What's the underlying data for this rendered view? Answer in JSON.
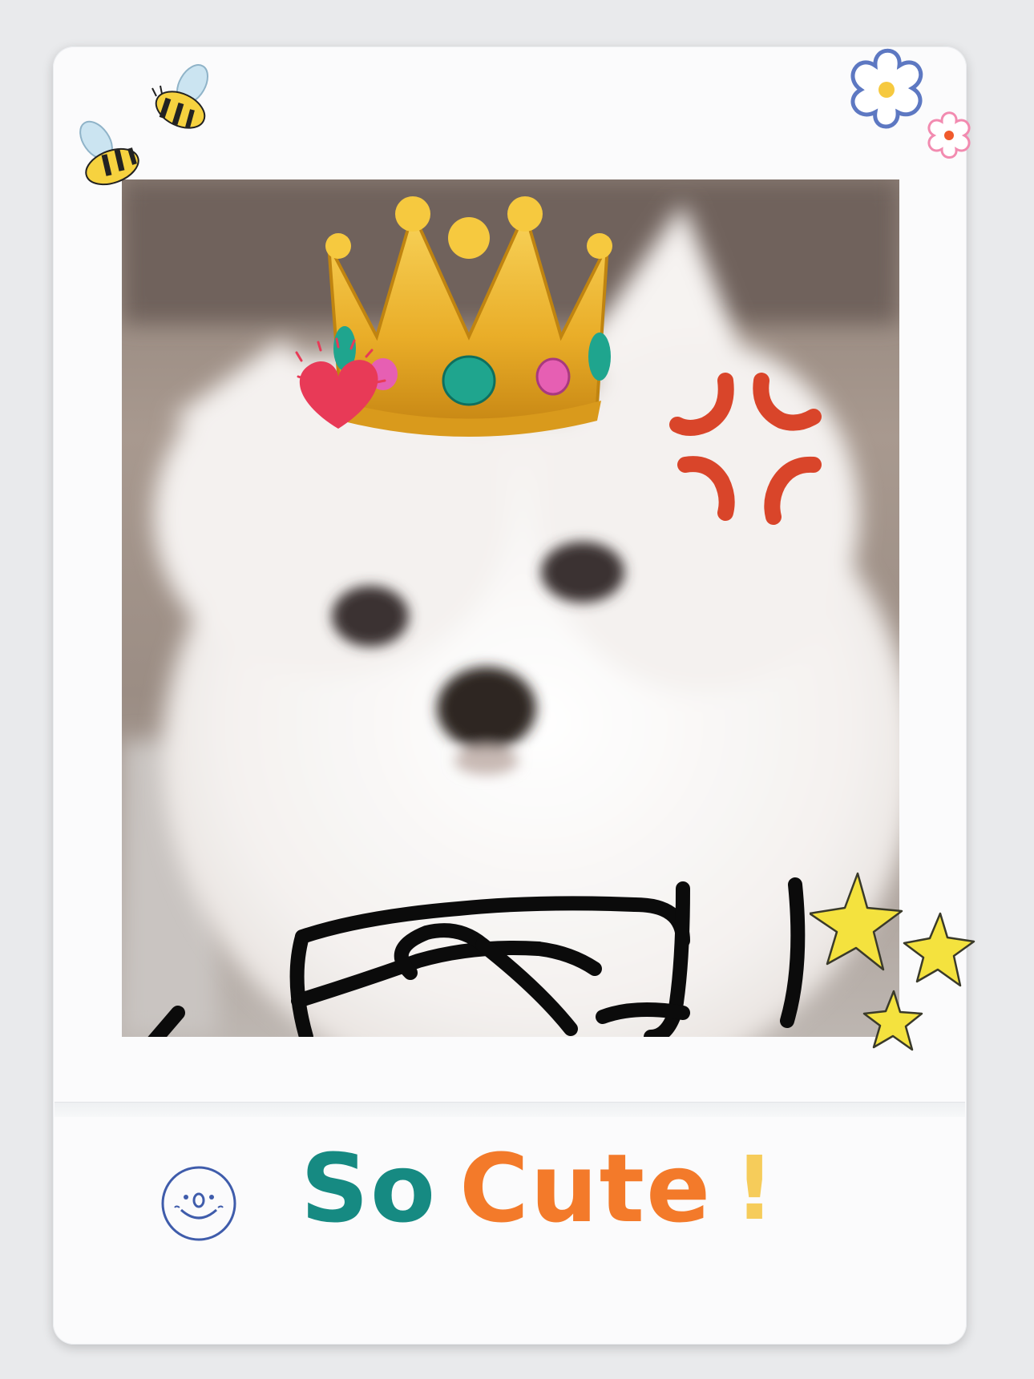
{
  "caption": {
    "word1": "So",
    "word2": "Cute",
    "punct": "!"
  },
  "colors": {
    "frame": "#fbfbfc",
    "background": "#e9eaec",
    "so": "#168a82",
    "cute": "#f37a2a",
    "exclamation": "#f6cc5a",
    "smiley_outline": "#3f5cab"
  },
  "stickers": [
    "bee-icon",
    "bee-icon",
    "flower-icon",
    "flower-icon",
    "crown-icon",
    "heart-icon",
    "anger-mark-icon",
    "crossed-arms-doodle",
    "star-icon",
    "star-icon",
    "star-icon",
    "smiley-face-icon"
  ]
}
